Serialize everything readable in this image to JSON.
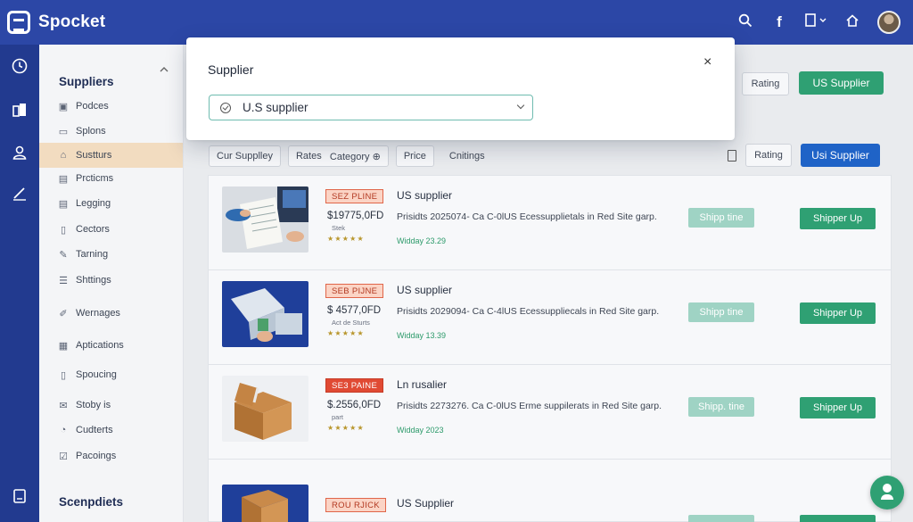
{
  "app": {
    "name": "Spocket"
  },
  "colors": {
    "topbar": "#2c47a6",
    "rail": "#223a8f",
    "accent_green": "#2fa073",
    "accent_blue": "#1f63c7",
    "active_side": "#f2dcc0"
  },
  "topbar": {
    "icons": [
      "search-icon",
      "facebook-icon",
      "document-dropdown-icon",
      "home-icon",
      "avatar"
    ]
  },
  "sidebar": {
    "heading": "Suppliers",
    "items": [
      {
        "label": "Podces",
        "icon": "▣"
      },
      {
        "label": "Splons",
        "icon": "▭"
      },
      {
        "label": "Sustturs",
        "icon": "⌂"
      },
      {
        "label": "Prcticms",
        "icon": "▤"
      },
      {
        "label": "Legging",
        "icon": "▤"
      },
      {
        "label": "Cectors",
        "icon": "▯"
      },
      {
        "label": "Tarning",
        "icon": "✎"
      },
      {
        "label": "Shttings",
        "icon": "☰"
      },
      {
        "label": "Wernages",
        "icon": "✐"
      },
      {
        "label": "Aptications",
        "icon": "▦"
      },
      {
        "label": "Spoucing",
        "icon": "▯"
      },
      {
        "label": "Stoby is",
        "icon": "✉"
      },
      {
        "label": "Cudterts",
        "icon": "◔"
      },
      {
        "label": "Pacoings",
        "icon": "☑"
      }
    ],
    "footer": "Scenpdiets"
  },
  "filters": {
    "chips": [
      "Cur Supplley",
      "Rates",
      "Category ⊕",
      "Price"
    ],
    "plain": "Cnitings",
    "rating": "Rating",
    "us_supplier": "Usi Supplier",
    "top_rating": "Rating",
    "top_us_supplier": "US Supplier"
  },
  "modal": {
    "title": "Supplier",
    "close": "×",
    "select_value": "U.S supplier"
  },
  "products": [
    {
      "badge": "SEZ PLINE",
      "badge_style": "light",
      "price": "$19775,0FD",
      "sub": "Stek",
      "stars": "★★★★★",
      "title": "US supplier",
      "desc": "Prisidts 2025074- Ca C-0lUS Ecessupplietals in Red Site garp.",
      "date": "Widday 23.29",
      "ship": "Shipp tine",
      "action": "Shipper Up",
      "thumb": "papers"
    },
    {
      "badge": "SEB PIJNE",
      "badge_style": "light",
      "price": "$ 4577,0FD",
      "sub": "Act de Sturts",
      "stars": "★★★★★",
      "title": "US supplier",
      "desc": "Prisidts 2029094- Ca C-4lUS Ecessuppliecals in Red Site garp.",
      "date": "Widday 13.39",
      "ship": "Shipp tine",
      "action": "Shipper Up",
      "thumb": "blue"
    },
    {
      "badge": "SE3 PAINE",
      "badge_style": "red",
      "price": "$.2556,0FD",
      "sub": "part",
      "stars": "★★★★★",
      "title": "Ln rusalier",
      "desc": "Prisidts 2273276. Ca C-0lUS Erme suppilerats in Red Site garp.",
      "date": "Widday 2023",
      "ship": "Shipp. tine",
      "action": "Shipper Up",
      "thumb": "boxes"
    },
    {
      "badge": "ROU RJICK",
      "badge_style": "light",
      "price": "",
      "sub": "",
      "stars": "",
      "title": "US Supplier",
      "desc": "",
      "date": "",
      "ship": "",
      "action": "",
      "thumb": "boxes2"
    }
  ]
}
